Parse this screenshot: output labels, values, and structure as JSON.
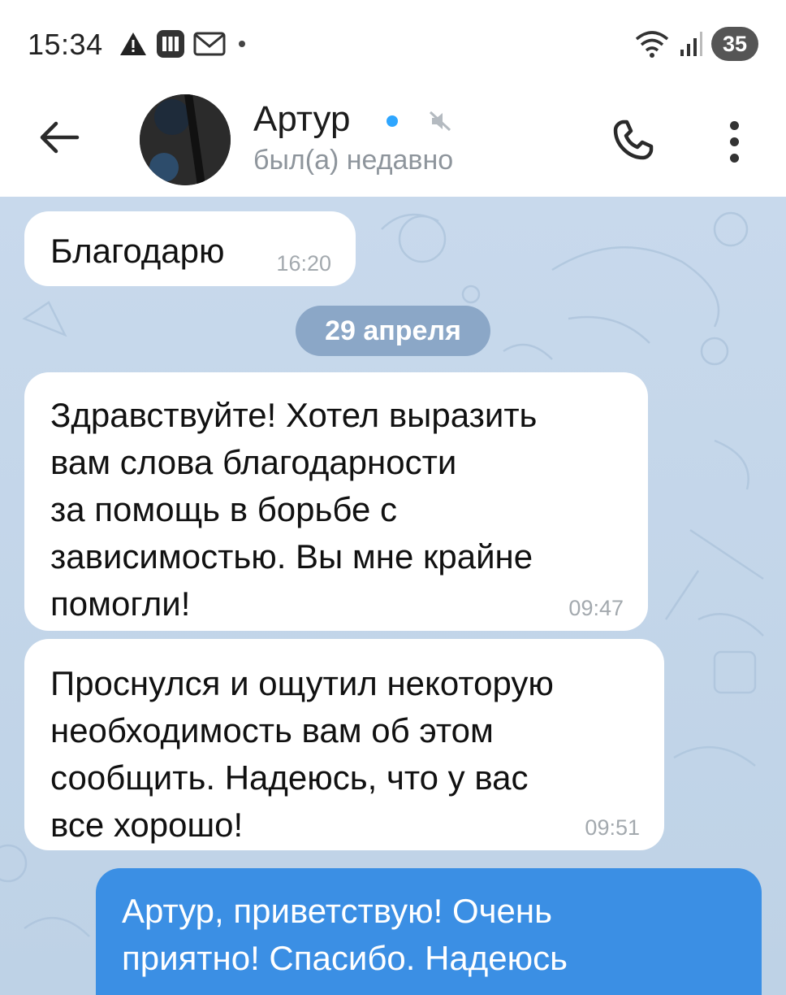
{
  "status_bar": {
    "time": "15:34",
    "battery": "35",
    "left_icons": [
      "warning-icon",
      "app-icon",
      "gmail-icon",
      "dot-icon"
    ],
    "right_icons": [
      "wifi-icon",
      "signal-icon",
      "battery-icon"
    ]
  },
  "header": {
    "contact_name": "Артур",
    "contact_status": "был(а) недавно",
    "online_color": "#2ea6ff",
    "icons": [
      "back-arrow-icon",
      "avatar",
      "mute-icon",
      "phone-icon",
      "more-vertical-icon"
    ]
  },
  "chat": {
    "messages": [
      {
        "text": "Благодарю",
        "time": "16:20",
        "outgoing": false
      },
      {
        "text": "Здравствуйте! Хотел выразить\nвам слова благодарности\nза помощь в борьбе с\nзависимостью. Вы мне крайне\nпомогли!",
        "time": "09:47",
        "outgoing": false
      },
      {
        "text": "Проснулся и ощутил некоторую\nнеобходимость вам об этом\nсообщить. Надеюсь, что у вас\nвсе хорошо!",
        "time": "09:51",
        "outgoing": false
      },
      {
        "text": "Артур, приветствую! Очень\nприятно! Спасибо. Надеюсь",
        "time": "",
        "outgoing": true
      }
    ],
    "date_separator": "29 апреля",
    "colors": {
      "incoming_bubble": "#ffffff",
      "outgoing_bubble": "#3b8fe4",
      "background": "#c8d9ec"
    }
  }
}
